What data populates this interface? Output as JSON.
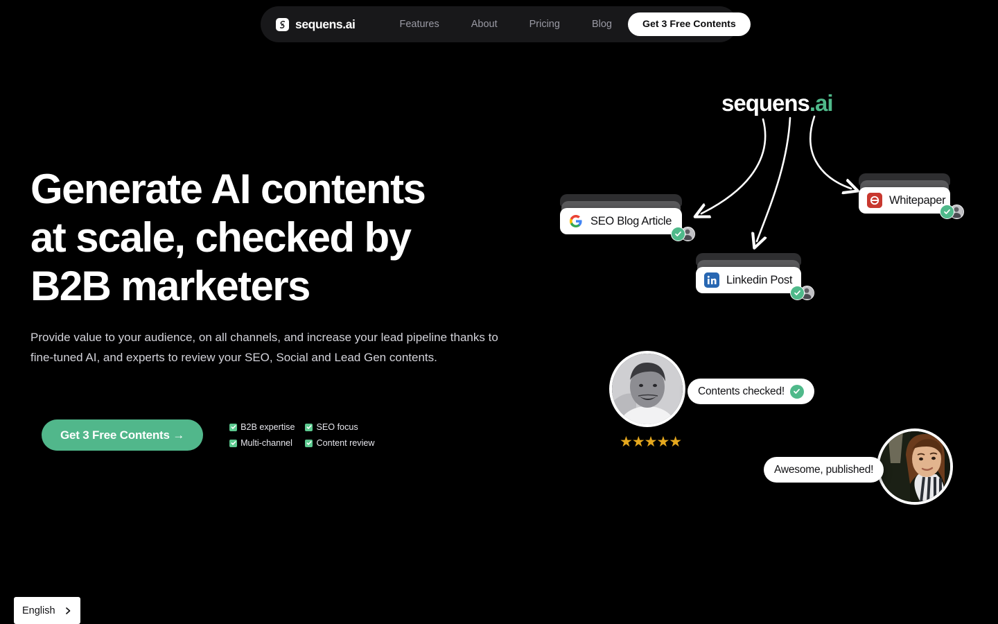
{
  "theme": {
    "background": "#000000",
    "header_bg": "#18181a",
    "accent_green": "#51b78b",
    "wordmark_green": "#4fb98a",
    "star_gold": "#e5a81e",
    "nav_text": "#9a9aa4"
  },
  "header": {
    "brand": "sequens.ai",
    "brand_icon": "sequens-logo-icon",
    "nav": [
      {
        "label": "Features"
      },
      {
        "label": "About"
      },
      {
        "label": "Pricing"
      },
      {
        "label": "Blog"
      }
    ],
    "cta_label": "Get 3 Free Contents"
  },
  "hero": {
    "title": "Generate AI contents\nat scale, checked by\nB2B marketers",
    "subtitle": "Provide value to your audience, on all channels, and increase your lead pipeline thanks to fine-tuned AI, and experts to review your SEO, Social and Lead Gen contents.",
    "cta_label": "Get 3 Free Contents →",
    "checklist": [
      {
        "label": "B2B expertise"
      },
      {
        "label": "SEO focus"
      },
      {
        "label": "Multi-channel"
      },
      {
        "label": "Content review"
      }
    ]
  },
  "illustration": {
    "wordmark_primary": "sequens",
    "wordmark_accent": ".ai",
    "cards": [
      {
        "label": "SEO Blog Article",
        "icon": "google-icon"
      },
      {
        "label": "Linkedin Post",
        "icon": "linkedin-icon"
      },
      {
        "label": "Whitepaper",
        "icon": "whitepaper-icon"
      }
    ],
    "testimonials": [
      {
        "message": "Contents checked!",
        "has_check": true,
        "stars": "★★★★★",
        "star_count": 5
      },
      {
        "message": "Awesome, published!",
        "has_check": false
      }
    ]
  },
  "footer": {
    "language": "English",
    "language_chevron": "chevron-right-icon"
  }
}
